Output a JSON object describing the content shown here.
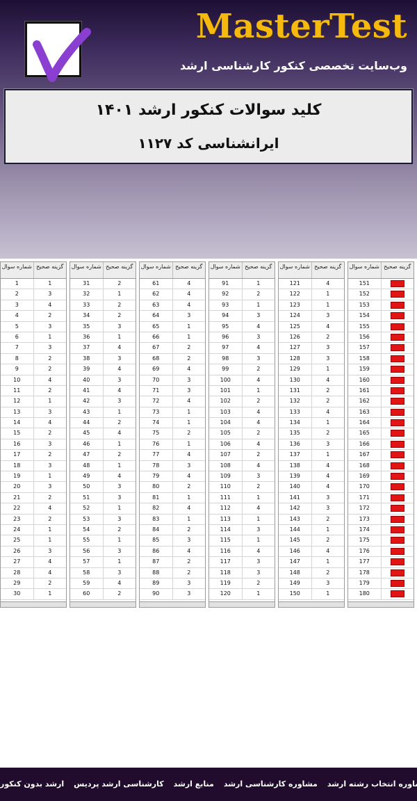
{
  "header": {
    "brand": "MasterTest",
    "tagline": "وب‌سایت تخصصی کنکور کارشناسی ارشد",
    "logo_icon": "checkmark-icon",
    "brand_color": "#f6b90e"
  },
  "title": {
    "line1": "کلید سوالات کنکور ارشد ۱۴۰۱",
    "line2": "ایرانشناسی کد ۱۱۲۷"
  },
  "table_headers": {
    "question": "شماره سوال",
    "answer": "گزینه صحیح"
  },
  "answer_key": [
    {
      "q": 1,
      "a": "1"
    },
    {
      "q": 2,
      "a": "3"
    },
    {
      "q": 3,
      "a": "4"
    },
    {
      "q": 4,
      "a": "2"
    },
    {
      "q": 5,
      "a": "3"
    },
    {
      "q": 6,
      "a": "1"
    },
    {
      "q": 7,
      "a": "3"
    },
    {
      "q": 8,
      "a": "2"
    },
    {
      "q": 9,
      "a": "2"
    },
    {
      "q": 10,
      "a": "4"
    },
    {
      "q": 11,
      "a": "2"
    },
    {
      "q": 12,
      "a": "1"
    },
    {
      "q": 13,
      "a": "3"
    },
    {
      "q": 14,
      "a": "4"
    },
    {
      "q": 15,
      "a": "2"
    },
    {
      "q": 16,
      "a": "3"
    },
    {
      "q": 17,
      "a": "2"
    },
    {
      "q": 18,
      "a": "3"
    },
    {
      "q": 19,
      "a": "1"
    },
    {
      "q": 20,
      "a": "3"
    },
    {
      "q": 21,
      "a": "2"
    },
    {
      "q": 22,
      "a": "4"
    },
    {
      "q": 23,
      "a": "2"
    },
    {
      "q": 24,
      "a": "1"
    },
    {
      "q": 25,
      "a": "1"
    },
    {
      "q": 26,
      "a": "3"
    },
    {
      "q": 27,
      "a": "4"
    },
    {
      "q": 28,
      "a": "4"
    },
    {
      "q": 29,
      "a": "2"
    },
    {
      "q": 30,
      "a": "1"
    },
    {
      "q": 31,
      "a": "2"
    },
    {
      "q": 32,
      "a": "1"
    },
    {
      "q": 33,
      "a": "2"
    },
    {
      "q": 34,
      "a": "2"
    },
    {
      "q": 35,
      "a": "3"
    },
    {
      "q": 36,
      "a": "1"
    },
    {
      "q": 37,
      "a": "4"
    },
    {
      "q": 38,
      "a": "3"
    },
    {
      "q": 39,
      "a": "4"
    },
    {
      "q": 40,
      "a": "3"
    },
    {
      "q": 41,
      "a": "4"
    },
    {
      "q": 42,
      "a": "3"
    },
    {
      "q": 43,
      "a": "1"
    },
    {
      "q": 44,
      "a": "2"
    },
    {
      "q": 45,
      "a": "4"
    },
    {
      "q": 46,
      "a": "1"
    },
    {
      "q": 47,
      "a": "2"
    },
    {
      "q": 48,
      "a": "1"
    },
    {
      "q": 49,
      "a": "4"
    },
    {
      "q": 50,
      "a": "3"
    },
    {
      "q": 51,
      "a": "3"
    },
    {
      "q": 52,
      "a": "1"
    },
    {
      "q": 53,
      "a": "3"
    },
    {
      "q": 54,
      "a": "2"
    },
    {
      "q": 55,
      "a": "1"
    },
    {
      "q": 56,
      "a": "3"
    },
    {
      "q": 57,
      "a": "1"
    },
    {
      "q": 58,
      "a": "3"
    },
    {
      "q": 59,
      "a": "4"
    },
    {
      "q": 60,
      "a": "2"
    },
    {
      "q": 61,
      "a": "4"
    },
    {
      "q": 62,
      "a": "4"
    },
    {
      "q": 63,
      "a": "4"
    },
    {
      "q": 64,
      "a": "3"
    },
    {
      "q": 65,
      "a": "1"
    },
    {
      "q": 66,
      "a": "1"
    },
    {
      "q": 67,
      "a": "2"
    },
    {
      "q": 68,
      "a": "2"
    },
    {
      "q": 69,
      "a": "4"
    },
    {
      "q": 70,
      "a": "3"
    },
    {
      "q": 71,
      "a": "3"
    },
    {
      "q": 72,
      "a": "4"
    },
    {
      "q": 73,
      "a": "1"
    },
    {
      "q": 74,
      "a": "1"
    },
    {
      "q": 75,
      "a": "2"
    },
    {
      "q": 76,
      "a": "1"
    },
    {
      "q": 77,
      "a": "4"
    },
    {
      "q": 78,
      "a": "3"
    },
    {
      "q": 79,
      "a": "4"
    },
    {
      "q": 80,
      "a": "2"
    },
    {
      "q": 81,
      "a": "1"
    },
    {
      "q": 82,
      "a": "4"
    },
    {
      "q": 83,
      "a": "1"
    },
    {
      "q": 84,
      "a": "2"
    },
    {
      "q": 85,
      "a": "3"
    },
    {
      "q": 86,
      "a": "4"
    },
    {
      "q": 87,
      "a": "2"
    },
    {
      "q": 88,
      "a": "2"
    },
    {
      "q": 89,
      "a": "3"
    },
    {
      "q": 90,
      "a": "3"
    },
    {
      "q": 91,
      "a": "1"
    },
    {
      "q": 92,
      "a": "2"
    },
    {
      "q": 93,
      "a": "1"
    },
    {
      "q": 94,
      "a": "3"
    },
    {
      "q": 95,
      "a": "4"
    },
    {
      "q": 96,
      "a": "3"
    },
    {
      "q": 97,
      "a": "4"
    },
    {
      "q": 98,
      "a": "3"
    },
    {
      "q": 99,
      "a": "2"
    },
    {
      "q": 100,
      "a": "4"
    },
    {
      "q": 101,
      "a": "1"
    },
    {
      "q": 102,
      "a": "2"
    },
    {
      "q": 103,
      "a": "4"
    },
    {
      "q": 104,
      "a": "4"
    },
    {
      "q": 105,
      "a": "2"
    },
    {
      "q": 106,
      "a": "4"
    },
    {
      "q": 107,
      "a": "2"
    },
    {
      "q": 108,
      "a": "4"
    },
    {
      "q": 109,
      "a": "3"
    },
    {
      "q": 110,
      "a": "2"
    },
    {
      "q": 111,
      "a": "1"
    },
    {
      "q": 112,
      "a": "4"
    },
    {
      "q": 113,
      "a": "1"
    },
    {
      "q": 114,
      "a": "3"
    },
    {
      "q": 115,
      "a": "1"
    },
    {
      "q": 116,
      "a": "4"
    },
    {
      "q": 117,
      "a": "3"
    },
    {
      "q": 118,
      "a": "3"
    },
    {
      "q": 119,
      "a": "2"
    },
    {
      "q": 120,
      "a": "1"
    },
    {
      "q": 121,
      "a": "4"
    },
    {
      "q": 122,
      "a": "1"
    },
    {
      "q": 123,
      "a": "1"
    },
    {
      "q": 124,
      "a": "3"
    },
    {
      "q": 125,
      "a": "4"
    },
    {
      "q": 126,
      "a": "2"
    },
    {
      "q": 127,
      "a": "3"
    },
    {
      "q": 128,
      "a": "3"
    },
    {
      "q": 129,
      "a": "1"
    },
    {
      "q": 130,
      "a": "4"
    },
    {
      "q": 131,
      "a": "2"
    },
    {
      "q": 132,
      "a": "2"
    },
    {
      "q": 133,
      "a": "4"
    },
    {
      "q": 134,
      "a": "1"
    },
    {
      "q": 135,
      "a": "2"
    },
    {
      "q": 136,
      "a": "3"
    },
    {
      "q": 137,
      "a": "1"
    },
    {
      "q": 138,
      "a": "4"
    },
    {
      "q": 139,
      "a": "4"
    },
    {
      "q": 140,
      "a": "4"
    },
    {
      "q": 141,
      "a": "3"
    },
    {
      "q": 142,
      "a": "3"
    },
    {
      "q": 143,
      "a": "2"
    },
    {
      "q": 144,
      "a": "1"
    },
    {
      "q": 145,
      "a": "2"
    },
    {
      "q": 146,
      "a": "4"
    },
    {
      "q": 147,
      "a": "1"
    },
    {
      "q": 148,
      "a": "2"
    },
    {
      "q": 149,
      "a": "3"
    },
    {
      "q": 150,
      "a": "1"
    },
    {
      "q": 151,
      "a": ""
    },
    {
      "q": 152,
      "a": ""
    },
    {
      "q": 153,
      "a": ""
    },
    {
      "q": 154,
      "a": ""
    },
    {
      "q": 155,
      "a": ""
    },
    {
      "q": 156,
      "a": ""
    },
    {
      "q": 157,
      "a": ""
    },
    {
      "q": 158,
      "a": ""
    },
    {
      "q": 159,
      "a": ""
    },
    {
      "q": 160,
      "a": ""
    },
    {
      "q": 161,
      "a": ""
    },
    {
      "q": 162,
      "a": ""
    },
    {
      "q": 163,
      "a": ""
    },
    {
      "q": 164,
      "a": ""
    },
    {
      "q": 165,
      "a": ""
    },
    {
      "q": 166,
      "a": ""
    },
    {
      "q": 167,
      "a": ""
    },
    {
      "q": 168,
      "a": ""
    },
    {
      "q": 169,
      "a": ""
    },
    {
      "q": 170,
      "a": ""
    },
    {
      "q": 171,
      "a": ""
    },
    {
      "q": 172,
      "a": ""
    },
    {
      "q": 173,
      "a": ""
    },
    {
      "q": 174,
      "a": ""
    },
    {
      "q": 175,
      "a": ""
    },
    {
      "q": 176,
      "a": ""
    },
    {
      "q": 177,
      "a": ""
    },
    {
      "q": 178,
      "a": ""
    },
    {
      "q": 179,
      "a": ""
    },
    {
      "q": 180,
      "a": ""
    }
  ],
  "cancelled_marker_color": "#e21414",
  "footer": {
    "links": [
      "ارشد بدون کنکور",
      "کارشناسی ارشد پردیس",
      "منابع ارشد",
      "مشاوره کارشناسی ارشد",
      "مشاوره انتخاب رشته ارشد"
    ]
  }
}
